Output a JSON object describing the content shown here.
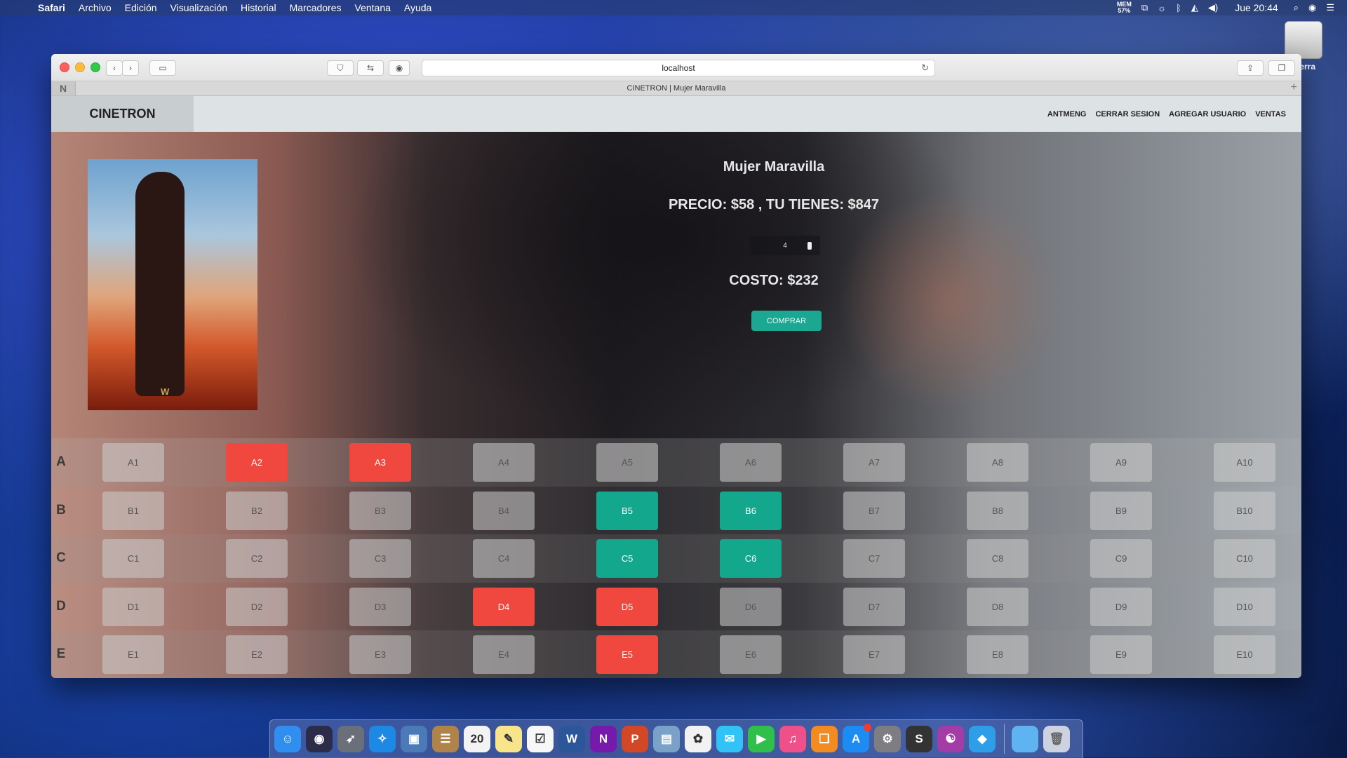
{
  "menubar": {
    "app_name": "Safari",
    "menus": [
      "Archivo",
      "Edición",
      "Visualización",
      "Historial",
      "Marcadores",
      "Ventana",
      "Ayuda"
    ],
    "status": {
      "mem_label": "MEM",
      "mem_value": "57%",
      "clock": "Jue 20:44"
    }
  },
  "desktop": {
    "disk_label": "Sierra"
  },
  "browser": {
    "url": "localhost",
    "tab_title": "CINETRON | Mujer Maravilla"
  },
  "site": {
    "brand": "CINETRON",
    "nav": [
      "ANTMENG",
      "CERRAR SESION",
      "AGREGAR USUARIO",
      "VENTAS"
    ]
  },
  "movie": {
    "title": "Mujer Maravilla",
    "price_line": "PRECIO: $58 , TU TIENES: $847",
    "quantity": "4",
    "cost_line": "COSTO: $232",
    "buy_label": "COMPRAR"
  },
  "seat_rows": [
    {
      "label": "A",
      "seats": [
        {
          "id": "A1",
          "status": "available"
        },
        {
          "id": "A2",
          "status": "taken"
        },
        {
          "id": "A3",
          "status": "taken"
        },
        {
          "id": "A4",
          "status": "available"
        },
        {
          "id": "A5",
          "status": "available"
        },
        {
          "id": "A6",
          "status": "available"
        },
        {
          "id": "A7",
          "status": "available"
        },
        {
          "id": "A8",
          "status": "available"
        },
        {
          "id": "A9",
          "status": "available"
        },
        {
          "id": "A10",
          "status": "available"
        }
      ]
    },
    {
      "label": "B",
      "seats": [
        {
          "id": "B1",
          "status": "available"
        },
        {
          "id": "B2",
          "status": "available"
        },
        {
          "id": "B3",
          "status": "available"
        },
        {
          "id": "B4",
          "status": "available"
        },
        {
          "id": "B5",
          "status": "selected"
        },
        {
          "id": "B6",
          "status": "selected"
        },
        {
          "id": "B7",
          "status": "available"
        },
        {
          "id": "B8",
          "status": "available"
        },
        {
          "id": "B9",
          "status": "available"
        },
        {
          "id": "B10",
          "status": "available"
        }
      ]
    },
    {
      "label": "C",
      "seats": [
        {
          "id": "C1",
          "status": "available"
        },
        {
          "id": "C2",
          "status": "available"
        },
        {
          "id": "C3",
          "status": "available"
        },
        {
          "id": "C4",
          "status": "available"
        },
        {
          "id": "C5",
          "status": "selected"
        },
        {
          "id": "C6",
          "status": "selected"
        },
        {
          "id": "C7",
          "status": "available"
        },
        {
          "id": "C8",
          "status": "available"
        },
        {
          "id": "C9",
          "status": "available"
        },
        {
          "id": "C10",
          "status": "available"
        }
      ]
    },
    {
      "label": "D",
      "seats": [
        {
          "id": "D1",
          "status": "available"
        },
        {
          "id": "D2",
          "status": "available"
        },
        {
          "id": "D3",
          "status": "available"
        },
        {
          "id": "D4",
          "status": "taken"
        },
        {
          "id": "D5",
          "status": "taken"
        },
        {
          "id": "D6",
          "status": "available"
        },
        {
          "id": "D7",
          "status": "available"
        },
        {
          "id": "D8",
          "status": "available"
        },
        {
          "id": "D9",
          "status": "available"
        },
        {
          "id": "D10",
          "status": "available"
        }
      ]
    },
    {
      "label": "E",
      "seats": [
        {
          "id": "E1",
          "status": "available"
        },
        {
          "id": "E2",
          "status": "available"
        },
        {
          "id": "E3",
          "status": "available"
        },
        {
          "id": "E4",
          "status": "available"
        },
        {
          "id": "E5",
          "status": "taken"
        },
        {
          "id": "E6",
          "status": "available"
        },
        {
          "id": "E7",
          "status": "available"
        },
        {
          "id": "E8",
          "status": "available"
        },
        {
          "id": "E9",
          "status": "available"
        },
        {
          "id": "E10",
          "status": "available"
        }
      ]
    }
  ],
  "colors": {
    "taken": "#f0483e",
    "selected": "#13a88e",
    "available": "#cdcdcd",
    "buy_button": "#1aa892"
  },
  "dock": {
    "calendar_day": "20",
    "apps": [
      {
        "name": "finder-icon",
        "color": "#2f8ef0",
        "glyph": "☺"
      },
      {
        "name": "siri-icon",
        "color": "#2c2c4a",
        "glyph": "◉"
      },
      {
        "name": "launchpad-icon",
        "color": "#6b6f7a",
        "glyph": "➶"
      },
      {
        "name": "safari-icon",
        "color": "#1e88e5",
        "glyph": "✧"
      },
      {
        "name": "preview-icon",
        "color": "#4c79b8",
        "glyph": "▣"
      },
      {
        "name": "contacts-icon",
        "color": "#b0834a",
        "glyph": "☰"
      },
      {
        "name": "calendar-icon",
        "color": "#f3f3f3",
        "glyph": ""
      },
      {
        "name": "notes-icon",
        "color": "#f8e48a",
        "glyph": "✎"
      },
      {
        "name": "reminders-icon",
        "color": "#f7f7f7",
        "glyph": "☑"
      },
      {
        "name": "word-icon",
        "color": "#2b579a",
        "glyph": "W"
      },
      {
        "name": "onenote-icon",
        "color": "#7719aa",
        "glyph": "N"
      },
      {
        "name": "powerpoint-icon",
        "color": "#d24726",
        "glyph": "P"
      },
      {
        "name": "image-capture-icon",
        "color": "#7aa2c8",
        "glyph": "▤"
      },
      {
        "name": "photos-icon",
        "color": "#f2f2f2",
        "glyph": "✿"
      },
      {
        "name": "messages-icon",
        "color": "#31c3f6",
        "glyph": "✉"
      },
      {
        "name": "facetime-icon",
        "color": "#2fbf4a",
        "glyph": "▶"
      },
      {
        "name": "itunes-icon",
        "color": "#f0508a",
        "glyph": "♫"
      },
      {
        "name": "ibooks-icon",
        "color": "#f28b22",
        "glyph": "❏"
      },
      {
        "name": "app-store-icon",
        "color": "#1c8cf3",
        "glyph": "A"
      },
      {
        "name": "system-preferences-icon",
        "color": "#7d7d82",
        "glyph": "⚙"
      },
      {
        "name": "sublime-icon",
        "color": "#333",
        "glyph": "S"
      },
      {
        "name": "github-icon",
        "color": "#a43ca8",
        "glyph": "☯"
      },
      {
        "name": "sequel-icon",
        "color": "#2e9ee8",
        "glyph": "◆"
      }
    ]
  }
}
